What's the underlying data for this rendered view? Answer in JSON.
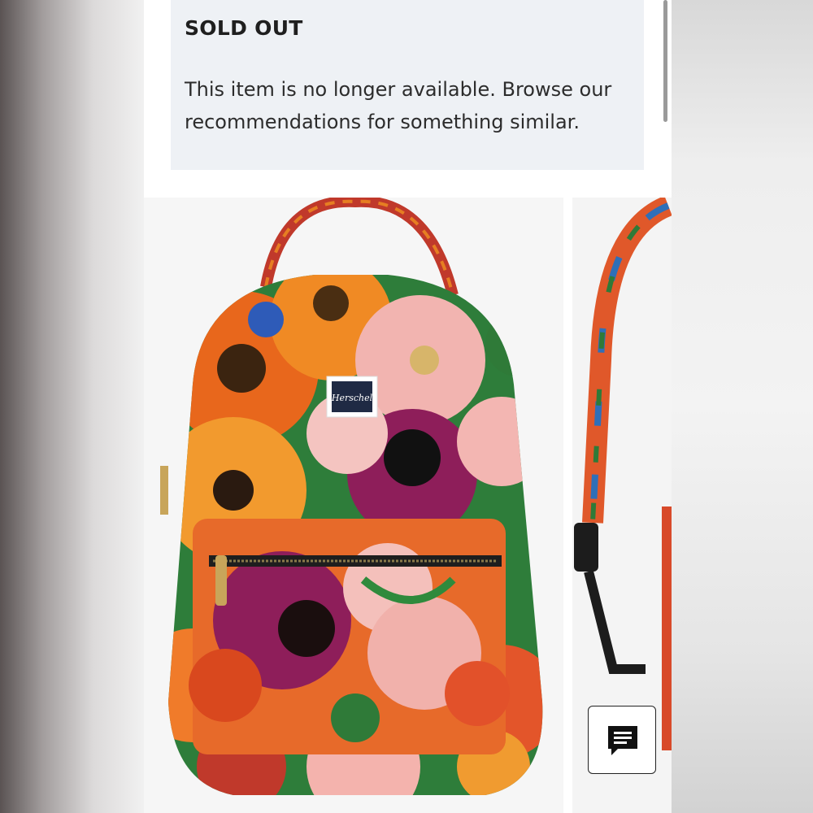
{
  "notice": {
    "title": "SOLD OUT",
    "body": "This item is no longer available. Browse our recommendations for something similar."
  },
  "gallery": {
    "images": [
      {
        "name": "floral-backpack-front",
        "brand_label": "Herschel"
      },
      {
        "name": "floral-backpack-side"
      }
    ]
  },
  "chat": {
    "icon": "chat-icon"
  },
  "colors": {
    "notice_bg": "#eef1f5",
    "text": "#1f1f1f",
    "strap": "#1c1c1c"
  }
}
